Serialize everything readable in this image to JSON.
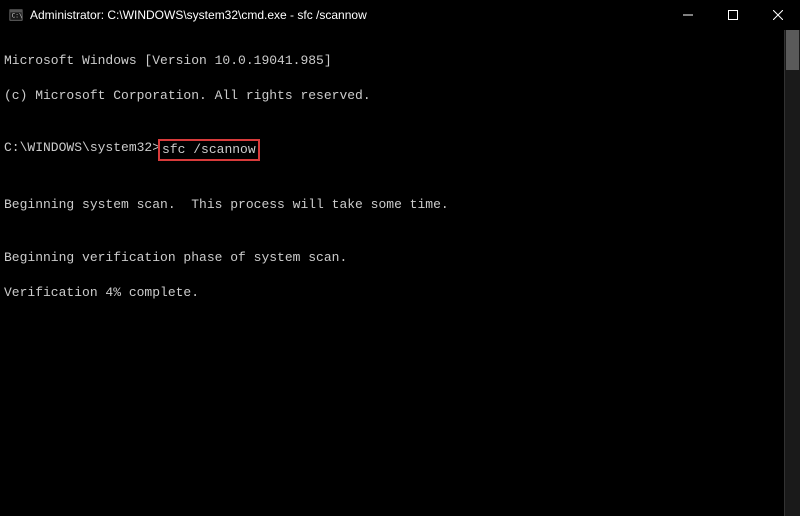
{
  "titlebar": {
    "title": "Administrator: C:\\WINDOWS\\system32\\cmd.exe - sfc  /scannow"
  },
  "terminal": {
    "line1": "Microsoft Windows [Version 10.0.19041.985]",
    "line2": "(c) Microsoft Corporation. All rights reserved.",
    "blank1": "",
    "prompt": "C:\\WINDOWS\\system32>",
    "command": "sfc /scannow",
    "blank2": "",
    "line3": "Beginning system scan.  This process will take some time.",
    "blank3": "",
    "line4": "Beginning verification phase of system scan.",
    "line5": "Verification 4% complete."
  }
}
